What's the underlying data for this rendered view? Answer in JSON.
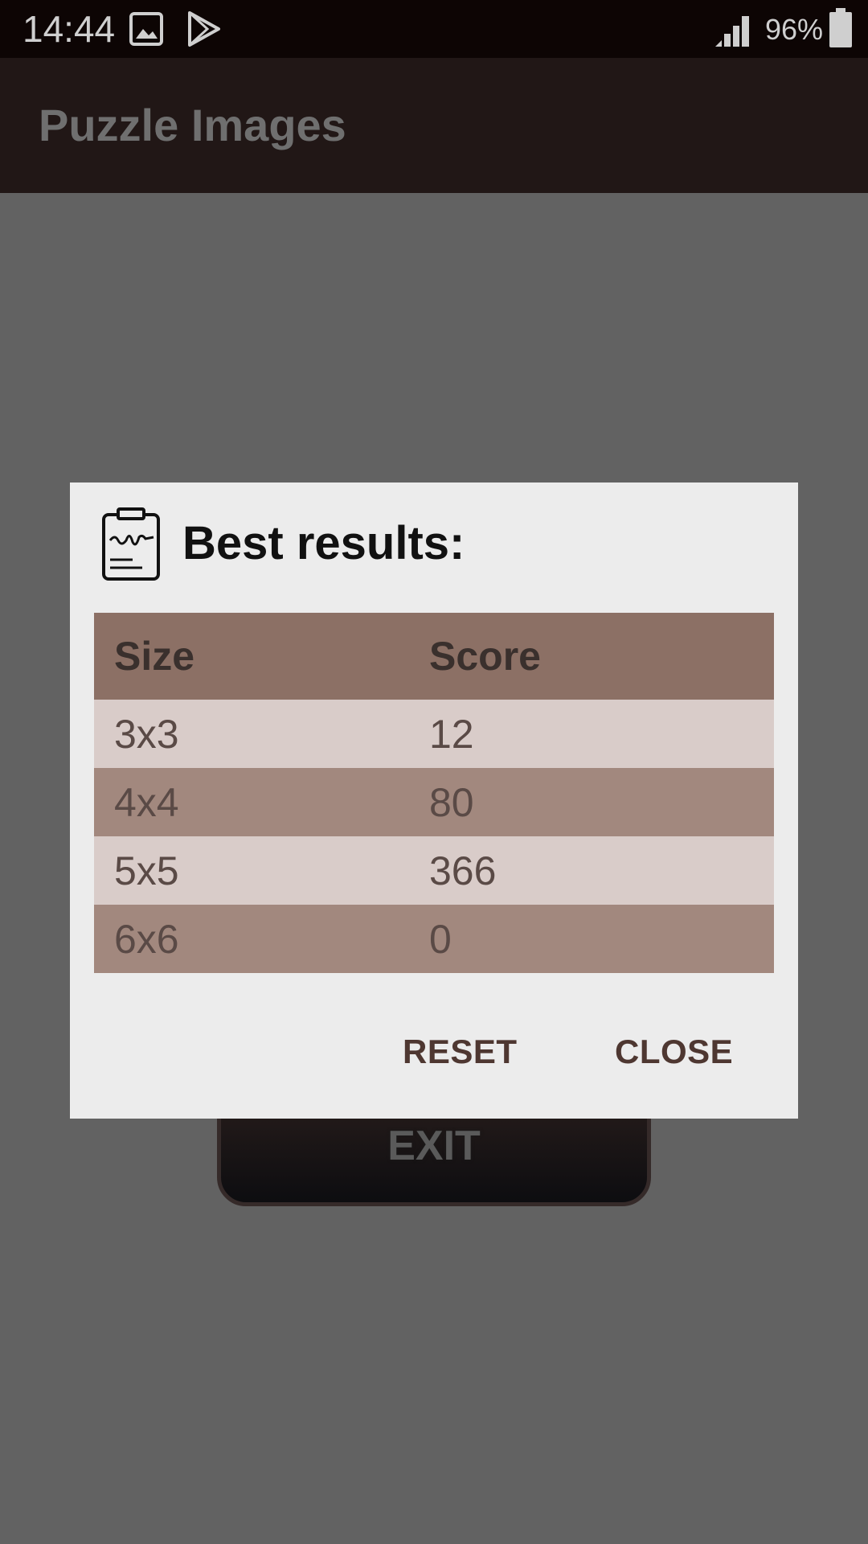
{
  "status_bar": {
    "time": "14:44",
    "battery": "96%",
    "icons": [
      "image-icon",
      "play-store-icon",
      "signal-icon",
      "battery-icon"
    ]
  },
  "app_bar": {
    "title": "Puzzle Images"
  },
  "background": {
    "exit_label": "EXIT"
  },
  "dialog": {
    "icon": "clipboard-icon",
    "title": "Best results:",
    "table": {
      "headers": [
        "Size",
        "Score"
      ],
      "rows": [
        {
          "size": "3x3",
          "score": "12"
        },
        {
          "size": "4x4",
          "score": "80"
        },
        {
          "size": "5x5",
          "score": "366"
        },
        {
          "size": "6x6",
          "score": "0"
        }
      ]
    },
    "reset_label": "RESET",
    "close_label": "CLOSE"
  },
  "colors": {
    "status_bar_bg": "#0d0504",
    "app_bar_bg": "#211716",
    "scrim_bg": "#626262",
    "dialog_bg": "#ececec",
    "table_header_bg": "#8c7065",
    "row_light_bg": "#d9ccc9",
    "row_dark_bg": "#a2887e",
    "button_text": "#4e3731"
  }
}
